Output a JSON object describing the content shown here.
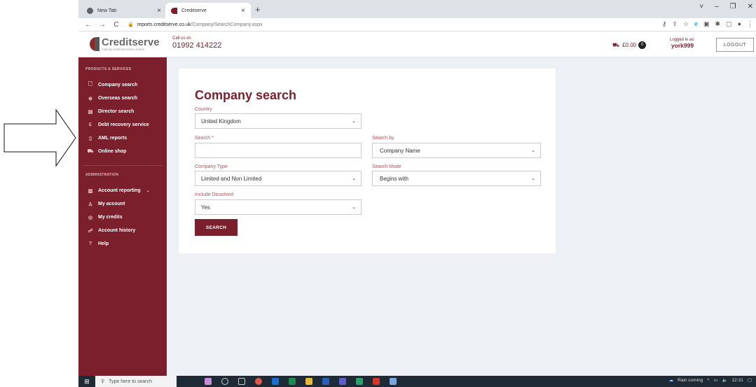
{
  "browser": {
    "tabs": [
      {
        "title": "New Tab",
        "icon_color": "#5f6368"
      },
      {
        "title": "Creditserve",
        "icon_color": "#7a1f2b"
      }
    ],
    "close_glyph": "×",
    "new_tab_glyph": "+",
    "window_controls": [
      "˅",
      "–",
      "❐",
      "✕"
    ],
    "nav": [
      "←",
      "→",
      "C"
    ],
    "url_host": "reports.creditserve.co.uk",
    "url_path": "/Company/SearchCompany.aspx"
  },
  "header": {
    "logo_name": "Creditserve",
    "logo_tagline": "making credit decisions clearer",
    "call_label": "Call us on",
    "phone": "01992 414222",
    "cart_total": "£0.00",
    "cart_count": "0",
    "logged_in_label": "Logged in as:",
    "username": "york999",
    "logout_label": "LOGOUT"
  },
  "sidebar": {
    "section1": "PRODUCTS & SERVICES",
    "products": [
      {
        "label": "Company search",
        "icon": "document-icon",
        "glyph": "🗋"
      },
      {
        "label": "Overseas search",
        "icon": "globe-icon",
        "glyph": "⊕"
      },
      {
        "label": "Director search",
        "icon": "id-card-icon",
        "glyph": "▤"
      },
      {
        "label": "Debt recovery service",
        "icon": "pound-icon",
        "glyph": "£"
      },
      {
        "label": "AML reports",
        "icon": "report-icon",
        "glyph": "▯"
      },
      {
        "label": "Online shop",
        "icon": "cart-icon",
        "glyph": "⛟"
      }
    ],
    "section2": "ADMINISTRATION",
    "admin": [
      {
        "label": "Account reporting",
        "icon": "chart-icon",
        "glyph": "▥",
        "has_chevron": true
      },
      {
        "label": "My account",
        "icon": "user-icon",
        "glyph": "♙"
      },
      {
        "label": "My credits",
        "icon": "coins-icon",
        "glyph": "◎"
      },
      {
        "label": "Account history",
        "icon": "users-icon",
        "glyph": "☍"
      },
      {
        "label": "Help",
        "icon": "help-icon",
        "glyph": "?"
      }
    ]
  },
  "form": {
    "title": "Company search",
    "country_label": "Country",
    "country_value": "United Kingdom",
    "search_label": "Search *",
    "search_value": "",
    "search_by_label": "Search by",
    "search_by_value": "Company Name",
    "company_type_label": "Company Type",
    "company_type_value": "Limited and Non Limited",
    "search_mode_label": "Search Mode",
    "search_mode_value": "Begins with",
    "include_dissolved_label": "Include Dissolved",
    "include_dissolved_value": "Yes",
    "search_button": "SEARCH"
  },
  "taskbar": {
    "search_placeholder": "Type here to search",
    "weather": "Rain coming",
    "time": "12:31"
  },
  "colors": {
    "brand": "#7a1f2b",
    "background": "#edf1f6"
  }
}
